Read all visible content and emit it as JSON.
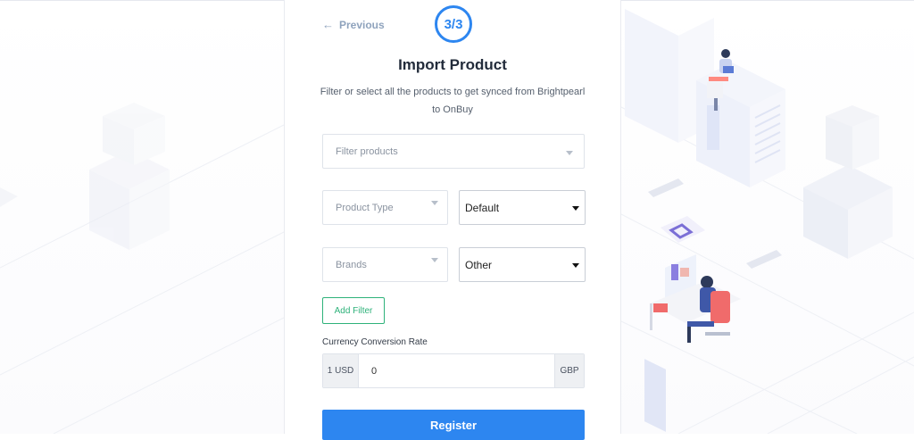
{
  "nav": {
    "previous_label": "Previous"
  },
  "step": {
    "indicator": "3/3"
  },
  "header": {
    "title": "Import Product",
    "subtitle_line1": "Filter or select all the products to get synced from Brightpearl",
    "subtitle_line2": "to OnBuy"
  },
  "filters": {
    "filter_products_placeholder": "Filter products",
    "product_type_placeholder": "Product Type",
    "product_type_operator": "Default",
    "brands_placeholder": "Brands",
    "brands_operator": "Other",
    "add_filter_label": "Add Filter"
  },
  "currency": {
    "label": "Currency Conversion Rate",
    "from": "1 USD",
    "rate_value": "0",
    "to": "GBP"
  },
  "actions": {
    "register_label": "Register"
  },
  "colors": {
    "accent": "#2d86f0",
    "success": "#2eb27a",
    "muted": "#8fa3bd"
  },
  "icons": {
    "previous": "arrow-left-icon",
    "dropdown": "chevron-down-icon"
  }
}
